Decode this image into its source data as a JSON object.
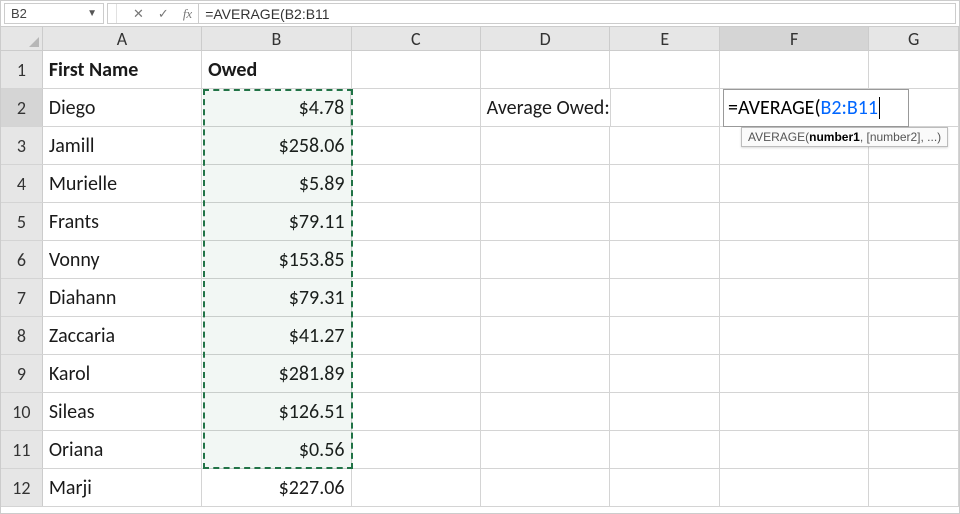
{
  "name_box": "B2",
  "formula_bar": "=AVERAGE(B2:B11",
  "fx_label": "fx",
  "column_labels": [
    "A",
    "B",
    "C",
    "D",
    "E",
    "F",
    "G"
  ],
  "row_labels": [
    "1",
    "2",
    "3",
    "4",
    "5",
    "6",
    "7",
    "8",
    "9",
    "10",
    "11",
    "12"
  ],
  "headers": {
    "A": "First Name",
    "B": "Owed"
  },
  "rows": [
    {
      "name": "Diego",
      "owed": "$4.78"
    },
    {
      "name": "Jamill",
      "owed": "$258.06"
    },
    {
      "name": "Murielle",
      "owed": "$5.89"
    },
    {
      "name": "Frants",
      "owed": "$79.11"
    },
    {
      "name": "Vonny",
      "owed": "$153.85"
    },
    {
      "name": "Diahann",
      "owed": "$79.31"
    },
    {
      "name": "Zaccaria",
      "owed": "$41.27"
    },
    {
      "name": "Karol",
      "owed": "$281.89"
    },
    {
      "name": "Sileas",
      "owed": "$126.51"
    },
    {
      "name": "Oriana",
      "owed": "$0.56"
    },
    {
      "name": "Marji",
      "owed": "$227.06"
    }
  ],
  "d2_label": "Average Owed:",
  "edit_formula": {
    "prefix": "=AVERAGE(",
    "ref": "B2:B11"
  },
  "tooltip": {
    "fn": "AVERAGE(",
    "arg_bold": "number1",
    "rest": ", [number2], ...)"
  },
  "chart_data": {
    "type": "table",
    "columns": [
      "First Name",
      "Owed"
    ],
    "data": [
      [
        "Diego",
        4.78
      ],
      [
        "Jamill",
        258.06
      ],
      [
        "Murielle",
        5.89
      ],
      [
        "Frants",
        79.11
      ],
      [
        "Vonny",
        153.85
      ],
      [
        "Diahann",
        79.31
      ],
      [
        "Zaccaria",
        41.27
      ],
      [
        "Karol",
        281.89
      ],
      [
        "Sileas",
        126.51
      ],
      [
        "Oriana",
        0.56
      ],
      [
        "Marji",
        227.06
      ]
    ],
    "formula_in_progress": "=AVERAGE(B2:B11",
    "formula_cell": "F2",
    "selected_range": "B2:B11"
  }
}
